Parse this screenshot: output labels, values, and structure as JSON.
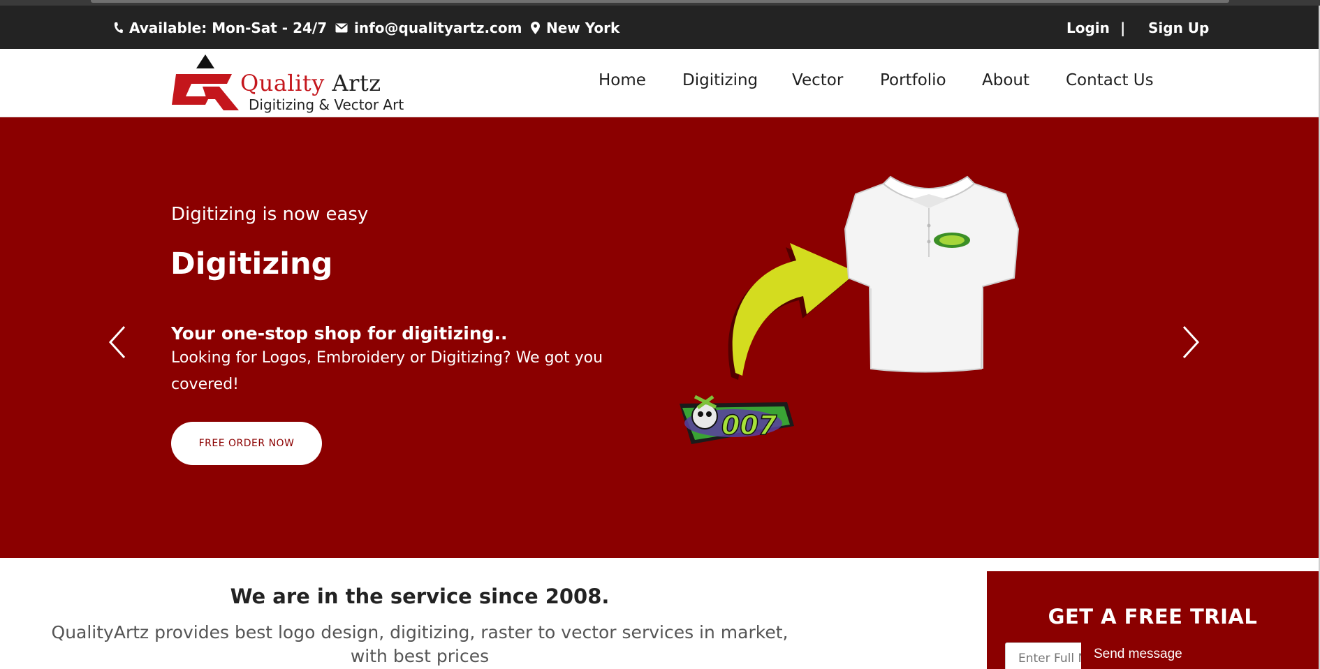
{
  "topbar": {
    "availability": "Available: Mon-Sat - 24/7",
    "email": "info@qualityartz.com",
    "location": "New York",
    "login": "Login",
    "separator": "|",
    "signup": "Sign Up"
  },
  "logo": {
    "brand_first": "Quality",
    "brand_second": "Artz",
    "tagline": "Digitizing & Vector Art"
  },
  "nav": [
    "Home",
    "Digitizing",
    "Vector",
    "Portfolio",
    "About",
    "Contact Us"
  ],
  "hero": {
    "subtitle": "Digitizing is now easy",
    "title": "Digitizing",
    "heading": "Your one-stop shop for digitizing..",
    "description": "Looking for Logos, Embroidery or Digitizing? We got you covered!",
    "cta": "FREE ORDER NOW",
    "badge_text": "007"
  },
  "service": {
    "since": "We are in the service since 2008.",
    "lead": "QualityArtz provides best logo design, digitizing, raster to vector services in market, with best prices"
  },
  "trial": {
    "title": "GET A FREE TRIAL",
    "name_placeholder": "Enter Full Name"
  },
  "chat": {
    "send_label": "Send message"
  },
  "colors": {
    "brand_red": "#8b0000",
    "logo_red": "#c4161c",
    "topbar_bg": "#232323",
    "arrow_yellow": "#d4dc1f"
  },
  "icons": [
    "phone-icon",
    "mail-icon",
    "location-pin-icon",
    "chevron-left-icon",
    "chevron-right-icon"
  ]
}
